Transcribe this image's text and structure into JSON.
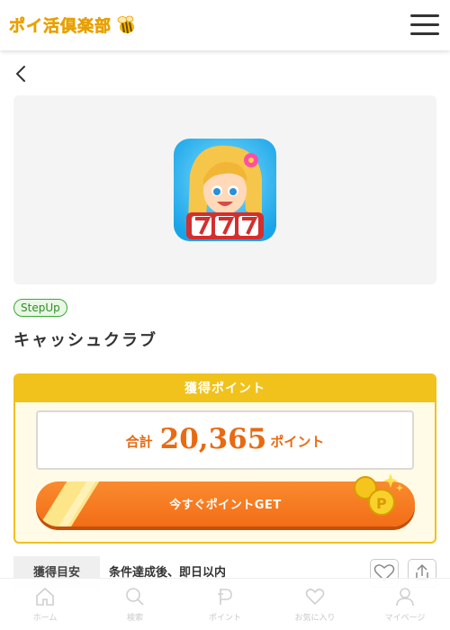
{
  "header": {
    "logo_text": "ポイ活倶楽部",
    "logo_icon": "bee-icon",
    "menu_icon": "hamburger-icon"
  },
  "nav": {
    "back_icon": "chevron-left-icon"
  },
  "offer": {
    "badge": "StepUp",
    "title": "キャッシュクラブ",
    "points_header": "獲得ポイント",
    "total_label": "合計",
    "total_value": "20,365",
    "total_unit": "ポイント",
    "cta_label": "今すぐポイントGET",
    "estimate_label": "獲得目安",
    "estimate_value": "条件達成後、即日以内"
  },
  "bottom_nav": {
    "items": [
      {
        "label": "ホーム",
        "icon": "home-icon"
      },
      {
        "label": "検索",
        "icon": "search-icon"
      },
      {
        "label": "ポイント",
        "icon": "point-icon"
      },
      {
        "label": "お気に入り",
        "icon": "heart-icon"
      },
      {
        "label": "マイページ",
        "icon": "person-icon"
      }
    ]
  },
  "colors": {
    "accent_yellow": "#f1c21b",
    "points_orange": "#e86a12",
    "button_orange": "#f36d17",
    "badge_green": "#3aa935"
  }
}
